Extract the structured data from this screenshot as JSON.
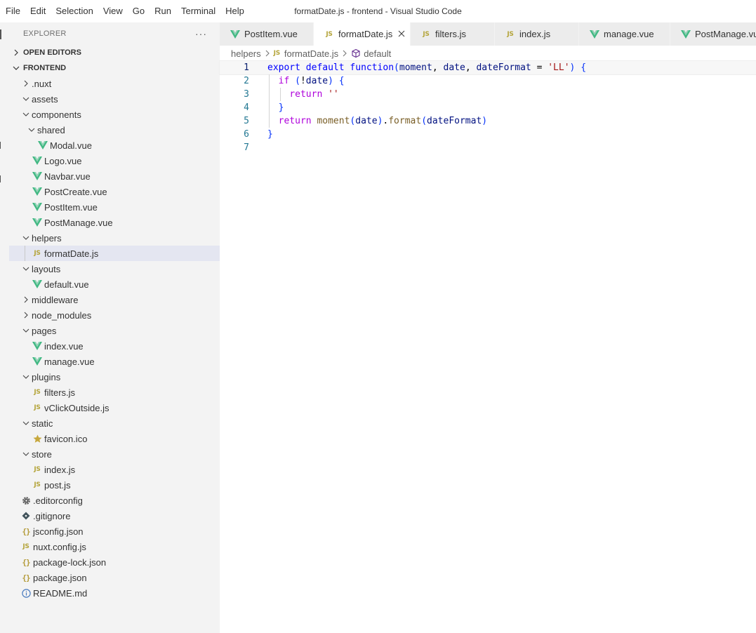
{
  "menu": [
    "File",
    "Edit",
    "Selection",
    "View",
    "Go",
    "Run",
    "Terminal",
    "Help"
  ],
  "window_title": "formatDate.js - frontend - Visual Studio Code",
  "sidebar": {
    "title": "EXPLORER",
    "more": "···",
    "open_editors": "OPEN EDITORS",
    "project": "FRONTEND",
    "items": [
      {
        "label": ".nuxt",
        "type": "folder",
        "expanded": false,
        "depth": 0
      },
      {
        "label": "assets",
        "type": "folder",
        "expanded": true,
        "depth": 0
      },
      {
        "label": "components",
        "type": "folder",
        "expanded": true,
        "depth": 0
      },
      {
        "label": "shared",
        "type": "folder",
        "expanded": true,
        "depth": 1
      },
      {
        "label": "Modal.vue",
        "type": "vue",
        "depth": 2
      },
      {
        "label": "Logo.vue",
        "type": "vue",
        "depth": 1
      },
      {
        "label": "Navbar.vue",
        "type": "vue",
        "depth": 1
      },
      {
        "label": "PostCreate.vue",
        "type": "vue",
        "depth": 1
      },
      {
        "label": "PostItem.vue",
        "type": "vue",
        "depth": 1
      },
      {
        "label": "PostManage.vue",
        "type": "vue",
        "depth": 1
      },
      {
        "label": "helpers",
        "type": "folder",
        "expanded": true,
        "depth": 0
      },
      {
        "label": "formatDate.js",
        "type": "js",
        "depth": 1,
        "selected": true
      },
      {
        "label": "layouts",
        "type": "folder",
        "expanded": true,
        "depth": 0
      },
      {
        "label": "default.vue",
        "type": "vue",
        "depth": 1
      },
      {
        "label": "middleware",
        "type": "folder",
        "expanded": false,
        "depth": 0
      },
      {
        "label": "node_modules",
        "type": "folder",
        "expanded": false,
        "depth": 0
      },
      {
        "label": "pages",
        "type": "folder",
        "expanded": true,
        "depth": 0
      },
      {
        "label": "index.vue",
        "type": "vue",
        "depth": 1
      },
      {
        "label": "manage.vue",
        "type": "vue",
        "depth": 1
      },
      {
        "label": "plugins",
        "type": "folder",
        "expanded": true,
        "depth": 0
      },
      {
        "label": "filters.js",
        "type": "js",
        "depth": 1
      },
      {
        "label": "vClickOutside.js",
        "type": "js",
        "depth": 1
      },
      {
        "label": "static",
        "type": "folder",
        "expanded": true,
        "depth": 0
      },
      {
        "label": "favicon.ico",
        "type": "star",
        "depth": 1
      },
      {
        "label": "store",
        "type": "folder",
        "expanded": true,
        "depth": 0
      },
      {
        "label": "index.js",
        "type": "js",
        "depth": 1
      },
      {
        "label": "post.js",
        "type": "js",
        "depth": 1
      },
      {
        "label": ".editorconfig",
        "type": "gear",
        "depth": 0
      },
      {
        "label": ".gitignore",
        "type": "git",
        "depth": 0
      },
      {
        "label": "jsconfig.json",
        "type": "json",
        "depth": 0
      },
      {
        "label": "nuxt.config.js",
        "type": "js",
        "depth": 0
      },
      {
        "label": "package-lock.json",
        "type": "json",
        "depth": 0
      },
      {
        "label": "package.json",
        "type": "json",
        "depth": 0
      },
      {
        "label": "README.md",
        "type": "info",
        "depth": 0
      }
    ]
  },
  "tabs": [
    {
      "label": "PostItem.vue",
      "type": "vue",
      "active": false
    },
    {
      "label": "formatDate.js",
      "type": "js",
      "active": true
    },
    {
      "label": "filters.js",
      "type": "js",
      "active": false
    },
    {
      "label": "index.js",
      "type": "js",
      "active": false
    },
    {
      "label": "manage.vue",
      "type": "vue",
      "active": false
    },
    {
      "label": "PostManage.vue",
      "type": "vue",
      "active": false
    }
  ],
  "breadcrumb": {
    "folder": "helpers",
    "file": "formatDate.js",
    "symbol": "default"
  },
  "code_lines": [
    "export default function(moment, date, dateFormat = 'LL') {",
    "  if (!date) {",
    "    return ''",
    "  }",
    "  return moment(date).format(dateFormat)",
    "}",
    ""
  ],
  "line_numbers": [
    "1",
    "2",
    "3",
    "4",
    "5",
    "6",
    "7"
  ],
  "colors": {
    "vue": "#41b883",
    "vue_dark": "#35495e",
    "js": "#b4a43a",
    "star": "#c7a83d",
    "info": "#4a7bbf"
  }
}
